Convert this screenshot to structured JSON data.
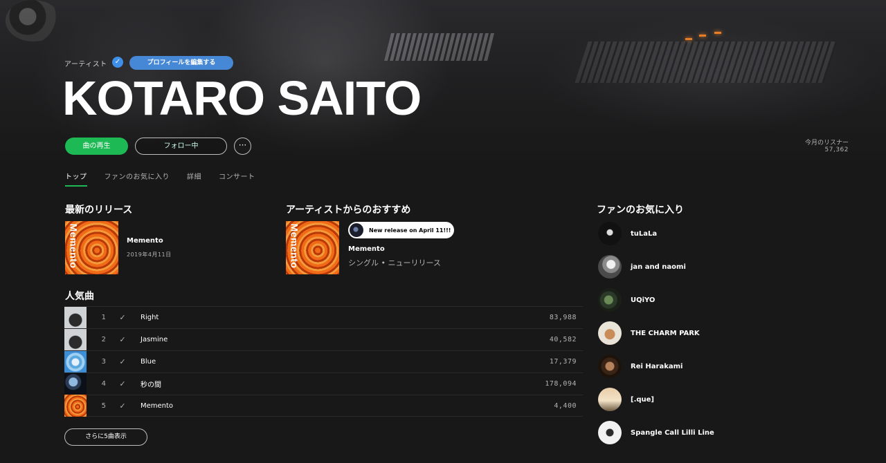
{
  "artist": {
    "tag": "アーティスト",
    "verified_mark": "✓",
    "edit_profile_label": "プロフィールを編集する",
    "name": "KOTARO SAITO",
    "play_label": "曲の再生",
    "follow_label": "フォロー中",
    "more_label": "···",
    "monthly_listeners_label": "今月のリスナー",
    "monthly_listeners": "57,362"
  },
  "tabs": [
    {
      "label": "トップ",
      "active": true
    },
    {
      "label": "ファンのお気に入り",
      "active": false
    },
    {
      "label": "詳細",
      "active": false
    },
    {
      "label": "コンサート",
      "active": false
    }
  ],
  "latest_release": {
    "heading": "最新のリリース",
    "title": "Memento",
    "date": "2019年4月11日",
    "cover_word": "Memento"
  },
  "recommendation": {
    "heading": "アーティストからのおすすめ",
    "badge": "New release on April 11!!!",
    "title": "Memento",
    "subtitle": "シングル • ニューリリース",
    "cover_word": "Memento"
  },
  "popular": {
    "heading": "人気曲",
    "check_mark": "✓",
    "tracks": [
      {
        "num": "1",
        "name": "Right",
        "plays": "83,988"
      },
      {
        "num": "2",
        "name": "Jasmine",
        "plays": "40,582"
      },
      {
        "num": "3",
        "name": "Blue",
        "plays": "17,379"
      },
      {
        "num": "4",
        "name": "秒の間",
        "plays": "178,094"
      },
      {
        "num": "5",
        "name": "Memento",
        "plays": "4,400"
      }
    ],
    "show_more_label": "さらに5曲表示"
  },
  "fans": {
    "heading": "ファンのお気に入り",
    "items": [
      {
        "name": "tuLaLa"
      },
      {
        "name": "jan and naomi"
      },
      {
        "name": "UQiYO"
      },
      {
        "name": "THE CHARM PARK"
      },
      {
        "name": "Rei Harakami"
      },
      {
        "name": "[.que]"
      },
      {
        "name": "Spangle Call Lilli Line"
      }
    ]
  },
  "colors": {
    "accent": "#1db954",
    "edit_button": "#4687d6",
    "background": "#181818"
  }
}
